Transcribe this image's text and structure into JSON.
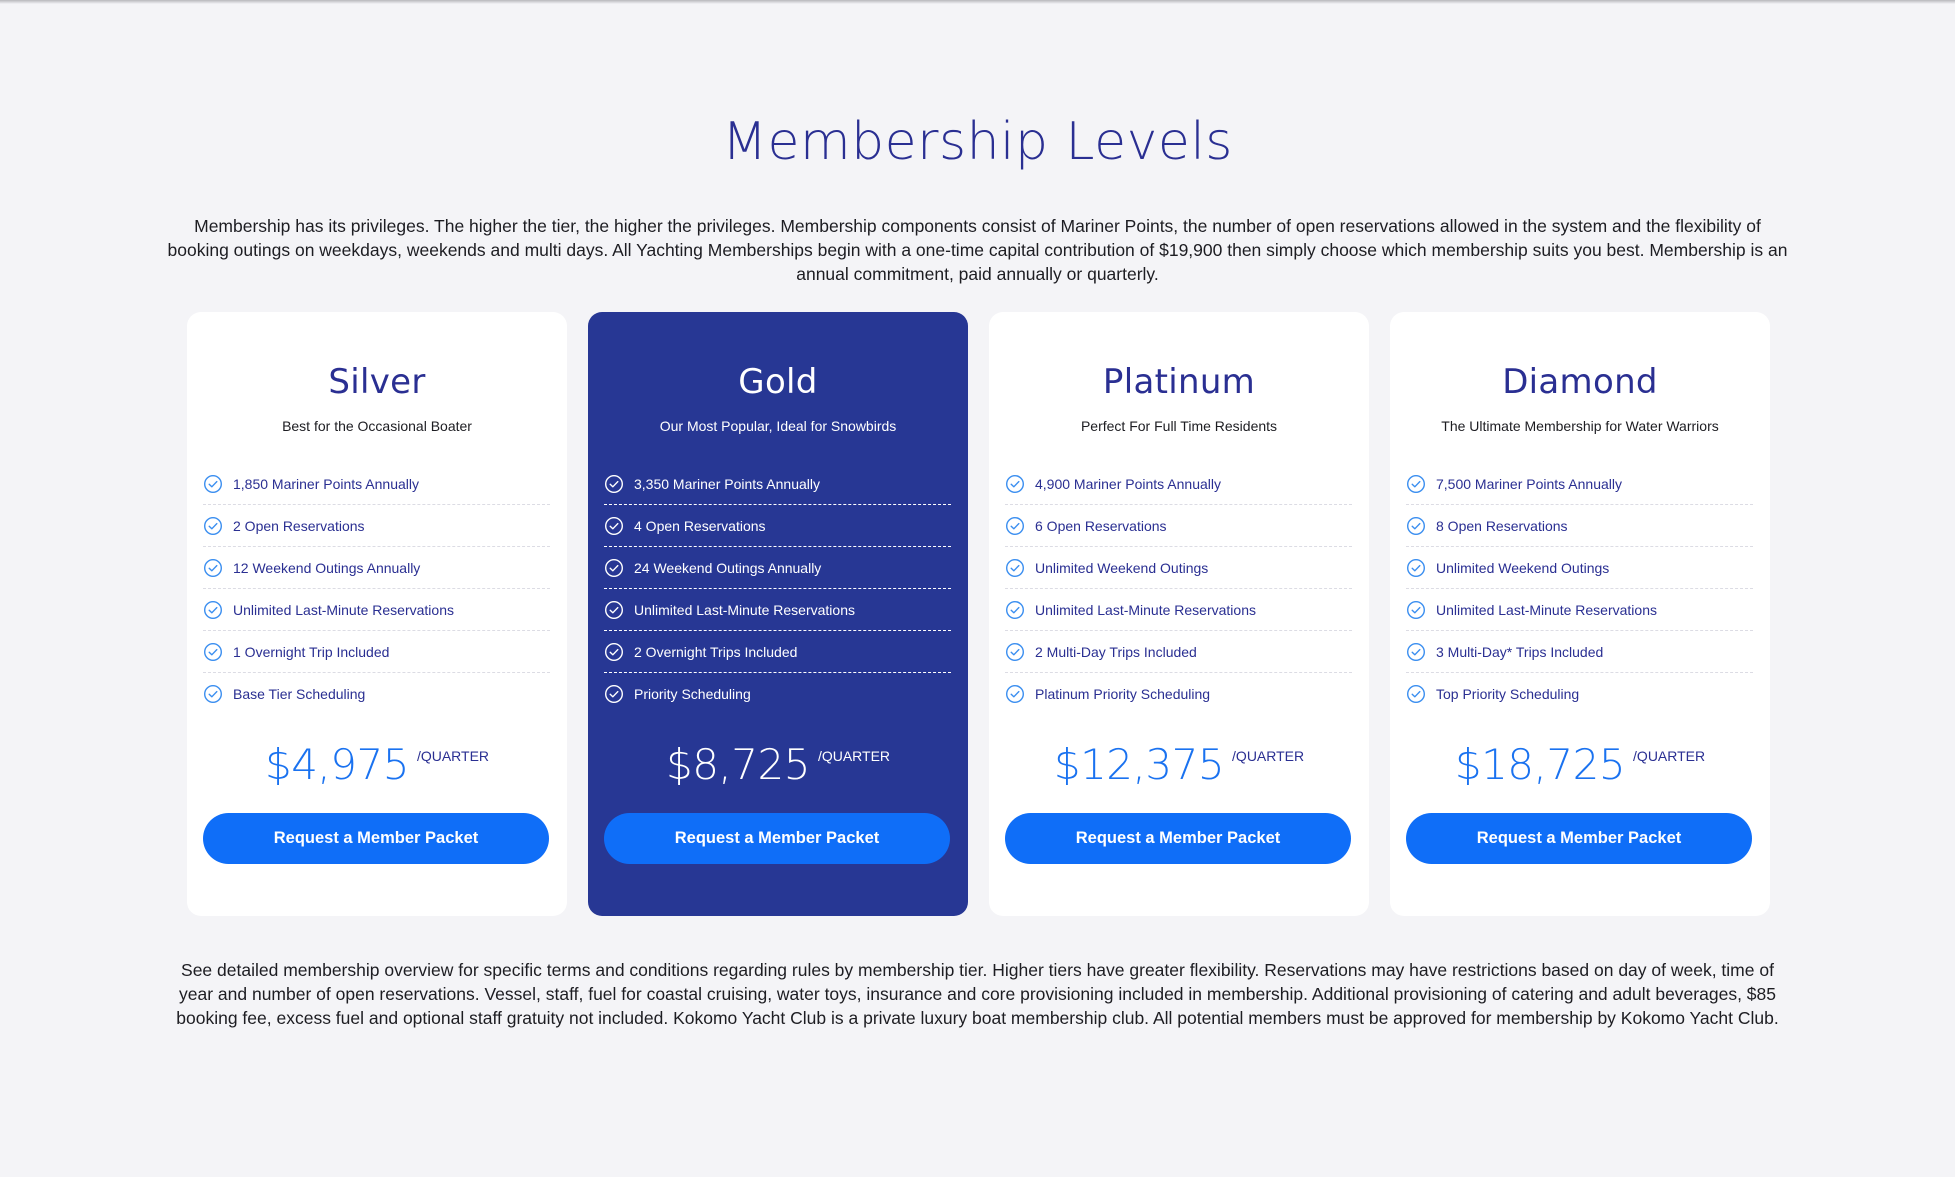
{
  "page": {
    "title": "Membership Levels",
    "intro": "Membership has its privileges. The higher the tier, the higher the privileges. Membership components consist of Mariner Points, the number of open reservations allowed in the system and the flexibility of booking outings on weekdays, weekends and multi days. All Yachting Memberships begin with a one-time capital contribution of $19,900 then simply choose which membership suits you best. Membership is an annual commitment, paid annually or quarterly.",
    "footnote": "See detailed membership overview for specific terms and conditions regarding rules by membership tier. Higher tiers have greater flexibility. Reservations may have restrictions based on day of week, time of year and number of open reservations. Vessel, staff, fuel for coastal cruising, water toys, insurance and core provisioning included in membership. Additional provisioning of catering and adult beverages, $85 booking fee, excess fuel and optional staff gratuity not included. Kokomo Yacht Club is a private luxury boat membership club. All potential members must be approved for membership by Kokomo Yacht Club."
  },
  "colors": {
    "background": "#f4f4f7",
    "heading": "#2a2f92",
    "featured_card": "#273794",
    "accent_blue": "#0f6ef8",
    "price_blue": "#1a72f0",
    "check_icon": "#3a8ef0"
  },
  "feature_icon": "check-circle-icon",
  "tiers": [
    {
      "name": "Silver",
      "subtitle": "Best for the Occasional Boater",
      "featured": false,
      "features": [
        "1,850 Mariner Points Annually",
        "2 Open Reservations",
        "12 Weekend Outings Annually",
        "Unlimited Last-Minute Reservations",
        "1 Overnight Trip Included",
        "Base Tier Scheduling"
      ],
      "price": "$4,975",
      "period": "/QUARTER",
      "cta": "Request a Member Packet"
    },
    {
      "name": "Gold",
      "subtitle": "Our Most Popular, Ideal for Snowbirds",
      "featured": true,
      "features": [
        "3,350 Mariner Points Annually",
        "4 Open Reservations",
        "24 Weekend Outings Annually",
        "Unlimited Last-Minute Reservations",
        "2 Overnight Trips Included",
        "Priority Scheduling"
      ],
      "price": "$8,725",
      "period": "/QUARTER",
      "cta": "Request a Member Packet"
    },
    {
      "name": "Platinum",
      "subtitle": "Perfect For Full Time Residents",
      "featured": false,
      "features": [
        "4,900 Mariner Points Annually",
        "6 Open Reservations",
        "Unlimited Weekend Outings",
        "Unlimited Last-Minute Reservations",
        "2 Multi-Day Trips Included",
        "Platinum Priority Scheduling"
      ],
      "price": "$12,375",
      "period": "/QUARTER",
      "cta": "Request a Member Packet"
    },
    {
      "name": "Diamond",
      "subtitle": "The Ultimate Membership for Water Warriors",
      "featured": false,
      "features": [
        "7,500 Mariner Points Annually",
        "8 Open Reservations",
        "Unlimited Weekend Outings",
        "Unlimited Last-Minute Reservations",
        "3 Multi-Day* Trips Included",
        "Top Priority Scheduling"
      ],
      "price": "$18,725",
      "period": "/QUARTER",
      "cta": "Request a Member Packet"
    }
  ]
}
